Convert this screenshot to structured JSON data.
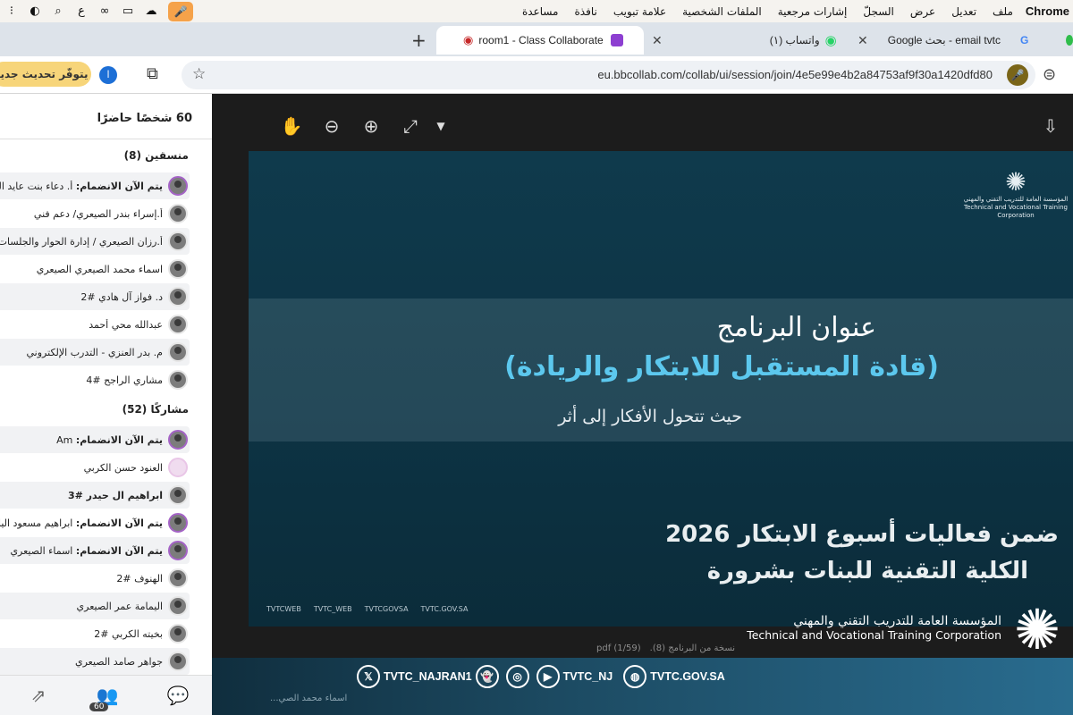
{
  "menubar": {
    "app": "Chrome",
    "items": [
      "ملف",
      "تعديل",
      "عرض",
      "السجلّ",
      "إشارات مرجعية",
      "الملفات الشخصية",
      "علامة تبويب",
      "نافذة",
      "مساعدة"
    ],
    "tray_lang": "ع"
  },
  "tabs": [
    {
      "label": "Google بحث - email tvtc"
    },
    {
      "label": "(١) واتساب"
    },
    {
      "label": "room1 - Class Collaborate"
    }
  ],
  "toolbar": {
    "url": "eu.bbcollab.com/collab/ui/session/join/4e5e99e4b2a84753af9f30a1420dfd80",
    "update_label": "يتوفّر تحديث جديد",
    "profile_initial": "ا"
  },
  "panel": {
    "title": "60 شخصًا حاضرًا",
    "moderators_header": "منسقين (8)",
    "participants_header": "مشاركًا (52)",
    "moderators": [
      {
        "prefix": "يتم الآن الانضمام:",
        "name": "أ. دعاء بنت عايد البلاد"
      },
      {
        "prefix": "",
        "name": "أ.إسراء بندر الصيعري/ دعم فني"
      },
      {
        "prefix": "",
        "name": "أ.رزان الصيعري / إدارة الحوار والجلسات"
      },
      {
        "prefix": "",
        "name": "اسماء محمد الصيعري الصيعري"
      },
      {
        "prefix": "",
        "name": "د. فواز آل هادي #2"
      },
      {
        "prefix": "",
        "name": "عبدالله محي أحمد"
      },
      {
        "prefix": "",
        "name": "م. بدر العنزي - التدرب الإلكتروني"
      },
      {
        "prefix": "",
        "name": "مشاري الراجح #4"
      }
    ],
    "participants": [
      {
        "prefix": "يتم الآن الانضمام:",
        "name": "Am"
      },
      {
        "prefix": "",
        "name": "العنود حسن الكربي"
      },
      {
        "prefix": "",
        "name": "ابراهيم ال حيدر #3"
      },
      {
        "prefix": "يتم الآن الانضمام:",
        "name": "ابراهيم مسعود اليامي"
      },
      {
        "prefix": "يتم الآن الانضمام:",
        "name": "اسماء الصيعري"
      },
      {
        "prefix": "",
        "name": "الهنوف #2"
      },
      {
        "prefix": "",
        "name": "اليمامة عمر الصيعري"
      },
      {
        "prefix": "",
        "name": "بخيته الكربي #2"
      },
      {
        "prefix": "",
        "name": "جواهر صامد الصيعري"
      }
    ],
    "badge_count": "60"
  },
  "slide": {
    "org_ar": "المؤسسة العامة للتدريب التقني والمهني",
    "org_en": "Technical and Vocational Training Corporation",
    "title_line1": "عنوان البرنامج",
    "title_line2": "(قادة المستقبل للابتكار والريادة)",
    "subtitle": "حيث تتحول الأفكار إلى أثر",
    "event_line1": "ضمن فعاليات أسبوع الابتكار 2026",
    "event_line2": "الكلية التقنية للبنات بشرورة",
    "socials": [
      "TVTCWEB",
      "TVTC_WEB",
      "TVTCGOVSA",
      "TVTC.GOV.SA"
    ]
  },
  "viewer": {
    "file_label": "نسخة من البرنامج (8).pdf",
    "page_indicator": "(1/59)"
  },
  "overlay": {
    "org_ar": "المؤسسة العامة للتدريب التقني والمهني",
    "org_en": "Technical and Vocational Training Corporation",
    "handle1": "TVTC_NAJRAN1",
    "handle2": "TVTC_NJ",
    "site": "TVTC.GOV.SA",
    "ghost_name": "اسماء محمد الصي..."
  }
}
